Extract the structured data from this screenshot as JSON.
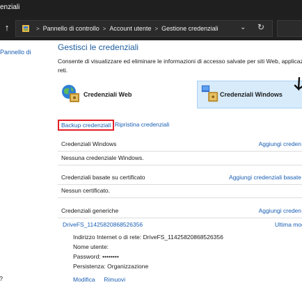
{
  "window": {
    "title": "enziali"
  },
  "address_bar": {
    "breadcrumbs": [
      "Pannello di controllo",
      "Account utente",
      "Gestione credenziali"
    ]
  },
  "sidebar": {
    "link": "Pannello di",
    "bottom_text": "?"
  },
  "main": {
    "title": "Gestisci le credenziali",
    "description": "Consente di visualizzare ed eliminare le informazioni di accesso salvate per siti Web, applicaz e reti.",
    "vault_web_label": "Credenziali Web",
    "vault_windows_label": "Credenziali Windows",
    "backup_label": "Backup credenziali",
    "restore_label": "Ripristina credenziali",
    "sections": [
      {
        "name": "Credenziali Windows",
        "action": "Aggiungi creden",
        "empty": "Nessuna credenziale Windows."
      },
      {
        "name": "Credenziali basate su certificato",
        "action": "Aggiungi credenziali basate",
        "empty": "Nessun certificato."
      },
      {
        "name": "Credenziali generiche",
        "action": "Aggiungi creden"
      }
    ],
    "generic_item": {
      "name": "DriveFS_11425820868526356",
      "modified": "Ultima modifi",
      "details": [
        "Indirizzo Internet o di rete:  DriveFS_11425820868526356",
        "Nome utente:",
        "Password:  ••••••••",
        "Persistenza:  Organizzazione"
      ],
      "edit_label": "Modifica",
      "remove_label": "Rimuovi"
    }
  },
  "colors": {
    "accent_link": "#1a5fb4",
    "heading": "#1d5e9e",
    "highlight_border": "#e21f26",
    "selected_bg": "#d7ebfb"
  },
  "icons": {
    "nav_up": "up-arrow-icon",
    "control_panel": "control-panel-icon",
    "dropdown": "chevron-down-icon",
    "refresh": "refresh-icon",
    "vault_web": "globe-vault-icon",
    "vault_windows": "windows-vault-icon"
  }
}
